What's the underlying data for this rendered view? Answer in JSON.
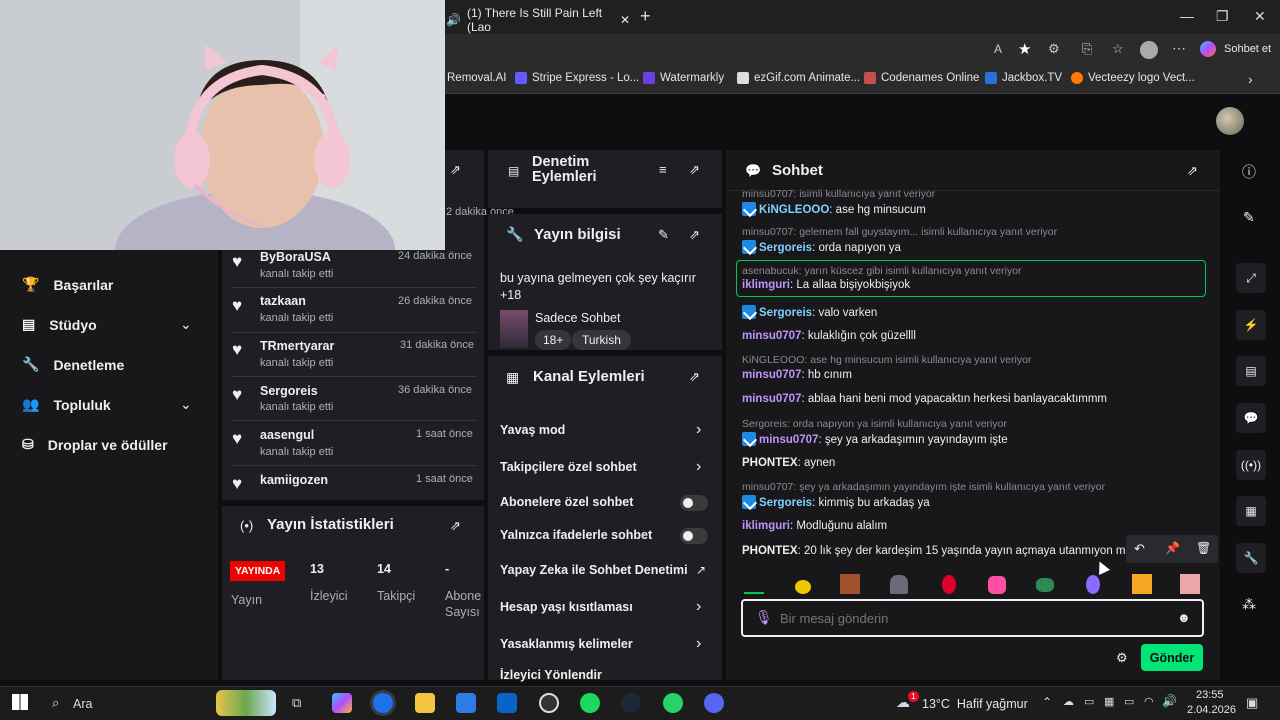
{
  "browser": {
    "tab_title": "(1) There Is Still Pain Left (Lao",
    "bookmarks": [
      "Removal.AI",
      "Stripe Express - Lo...",
      "Watermarkly",
      "ezGif.com Animate...",
      "Codenames Online",
      "Jackbox.TV",
      "Vecteezy logo Vect..."
    ],
    "copilot_label": "Sohbet et"
  },
  "left_nav": {
    "items": [
      {
        "label": "Başarılar",
        "icon": "trophy-icon"
      },
      {
        "label": "Stüdyo",
        "icon": "studio-icon",
        "expandable": true
      },
      {
        "label": "Denetleme",
        "icon": "wrench-icon"
      },
      {
        "label": "Topluluk",
        "icon": "community-icon",
        "expandable": true
      },
      {
        "label": "Droplar ve ödüller",
        "icon": "drops-icon"
      }
    ]
  },
  "activity": {
    "first_time": "2 dakika önce",
    "items": [
      {
        "name": "ByBoraUSA",
        "sub": "kanalı takip etti",
        "time": "24 dakika önce"
      },
      {
        "name": "tazkaan",
        "sub": "kanalı takip etti",
        "time": "26 dakika önce"
      },
      {
        "name": "TRmertyarar",
        "sub": "kanalı takip etti",
        "time": "31 dakika önce"
      },
      {
        "name": "Sergoreis",
        "sub": "kanalı takip etti",
        "time": "36 dakika önce"
      },
      {
        "name": "aasengul",
        "sub": "kanalı takip etti",
        "time": "1 saat önce"
      },
      {
        "name": "kamiigozen",
        "sub": "kanalı takip etti",
        "time": "1 saat önce"
      }
    ]
  },
  "stats": {
    "title": "Yayın İstatistikleri",
    "live_badge": "YAYINDA",
    "live_label": "Yayın",
    "viewers": "13",
    "viewers_label": "İzleyici",
    "followers": "14",
    "followers_label": "Takipçi",
    "subs": "-",
    "subs_label1": "Abone",
    "subs_label2": "Sayısı"
  },
  "mod_actions": {
    "title1": "Denetim",
    "title2": "Eylemleri"
  },
  "stream_info": {
    "title": "Yayın bilgisi",
    "stream_title1": "bu yayına gelmeyen çok şey kaçırır",
    "stream_title2": "+18",
    "category": "Sadece Sohbet",
    "tags": [
      "18+",
      "Turkish"
    ]
  },
  "channel_actions": {
    "title": "Kanal Eylemleri",
    "items": [
      {
        "label": "Yavaş mod",
        "control": "chevron"
      },
      {
        "label": "Takipçilere özel sohbet",
        "control": "chevron"
      },
      {
        "label": "Abonelere özel sohbet",
        "control": "toggle"
      },
      {
        "label": "Yalnızca ifadelerle sohbet",
        "control": "toggle"
      },
      {
        "label": "Yapay Zeka ile Sohbet Denetimi",
        "control": "external"
      },
      {
        "label": "Hesap yaşı kısıtlaması",
        "control": "chevron"
      },
      {
        "label": "Yasaklanmış kelimeler",
        "control": "chevron"
      },
      {
        "label": "İzleyici Yönlendir",
        "control": "none"
      }
    ]
  },
  "chat": {
    "title": "Sohbet",
    "input_placeholder": "Bir mesaj gönderin",
    "send_label": "Gönder",
    "messages": [
      {
        "reply": "minsu0707: isimli kullanıcıya yanıt veriyor",
        "user": "KiNGLEOOO",
        "color": "blue",
        "badge": true,
        "text": ": ase hg minsucum"
      },
      {
        "reply": "minsu0707: gelemem fall guystayım... isimli kullanıcıya yanıt veriyor",
        "user": "Sergoreis",
        "color": "blue",
        "badge": true,
        "text": ": orda napıyon ya"
      },
      {
        "reply": "asenabucuk: yarın küscez gibi isimli kullanıcıya yanıt veriyor",
        "user": "iklimguri",
        "color": "purp",
        "badge": false,
        "text": ": La allaa bişiyokbişiyok",
        "highlight": true
      },
      {
        "reply": "",
        "user": "Sergoreis",
        "color": "blue",
        "badge": true,
        "text": ": valo varken"
      },
      {
        "reply": "",
        "user": "minsu0707",
        "color": "purp",
        "badge": false,
        "text": ": kulaklığın çok güzellll"
      },
      {
        "reply": "KiNGLEOOO: ase hg minsucum isimli kullanıcıya yanıt veriyor",
        "user": "minsu0707",
        "color": "purp",
        "badge": false,
        "text": ": hb cınım"
      },
      {
        "reply": "",
        "user": "minsu0707",
        "color": "purp",
        "badge": false,
        "text": ": ablaa hani beni mod yapacaktın herkesi banlayacaktımmm"
      },
      {
        "reply": "Sergoreis: orda napıyon ya isimli kullanıcıya yanıt veriyor",
        "user": "minsu0707",
        "color": "purp",
        "badge": true,
        "text": ": şey ya arkadaşımın yayındayım işte"
      },
      {
        "reply": "",
        "user": "PHONTEX",
        "color": "white",
        "badge": false,
        "text": ": aynen"
      },
      {
        "reply": "minsu0707: şey ya arkadaşımın yayındayım işte isimli kullanıcıya yanıt veriyor",
        "user": "Sergoreis",
        "color": "blue",
        "badge": true,
        "text": ": kimmiş bu arkadaş ya"
      },
      {
        "reply": "",
        "user": "iklimguri",
        "color": "purp",
        "badge": false,
        "text": ": Modluğunu alalım"
      },
      {
        "reply": "",
        "user": "PHONTEX",
        "color": "white",
        "badge": false,
        "text": ": 20 lık şey der kardeşim 15 yaşında yayın açmaya utanmıyon mu"
      }
    ]
  },
  "taskbar": {
    "search_label": "Ara",
    "weather": "13°C  Hafif yağmur",
    "time": "23:55",
    "date": "2.04.2026",
    "notif_count": "1"
  },
  "colors": {
    "accent": "#9147ff",
    "send": "#00e676",
    "live": "#eb0400",
    "highlight": "#00c853"
  }
}
